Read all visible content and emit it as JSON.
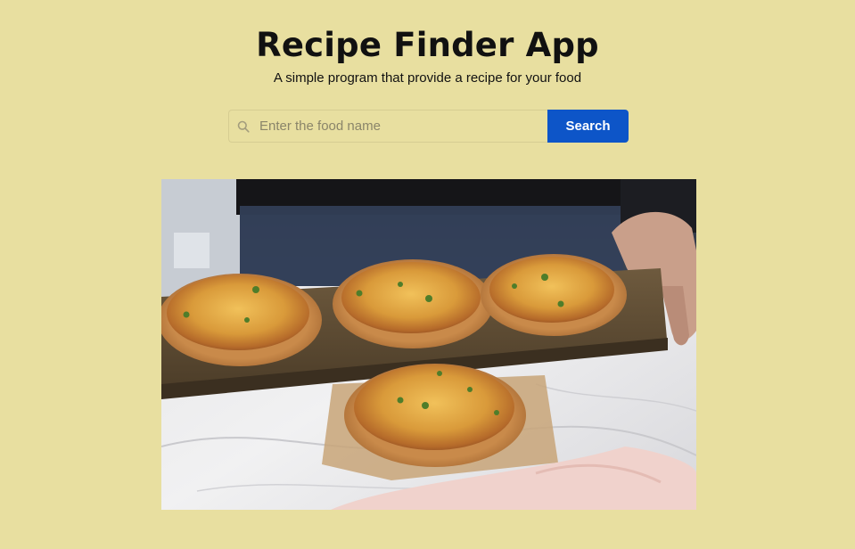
{
  "header": {
    "title": "Recipe Finder App",
    "subtitle": "A simple program that provide a recipe for your food"
  },
  "search": {
    "placeholder": "Enter the food name",
    "value": "",
    "button_label": "Search",
    "icon": "search-icon",
    "button_color": "#0d55c8"
  },
  "main": {
    "image_subject": "mini-pizzas-photo"
  },
  "colors": {
    "background": "#e8dfa0",
    "accent": "#0d55c8"
  }
}
